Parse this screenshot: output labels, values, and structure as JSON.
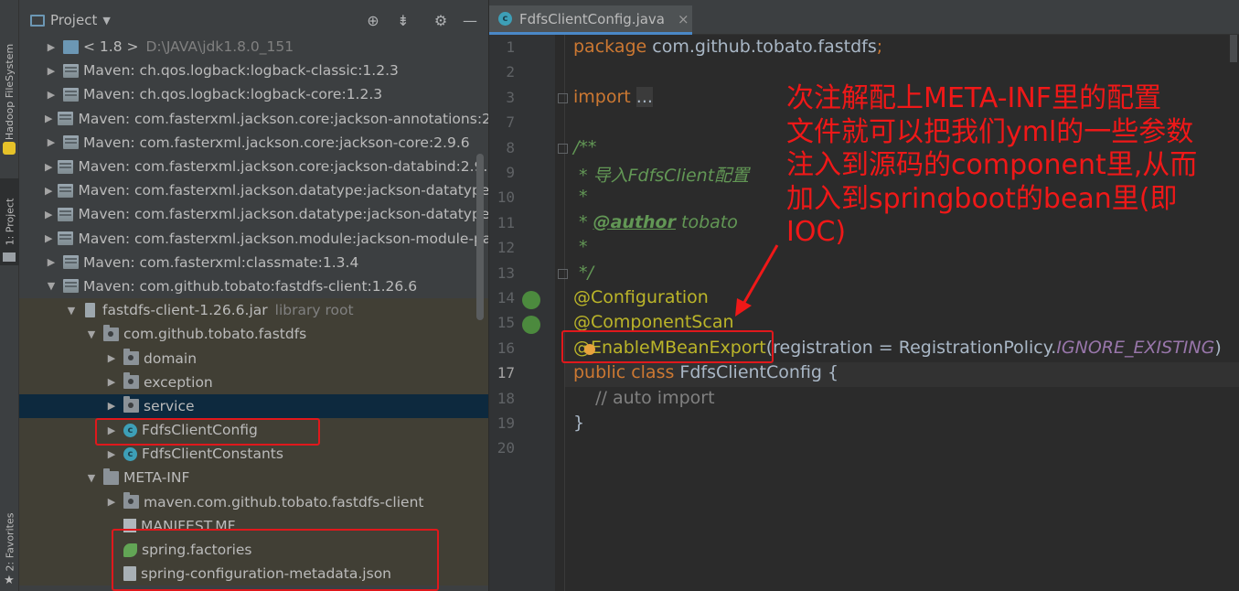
{
  "sidebar": {
    "tabs": [
      {
        "label": "Hadoop FileSystem"
      },
      {
        "label": "1: Project"
      },
      {
        "label": "2: Favorites"
      }
    ]
  },
  "project_panel": {
    "title": "Project",
    "toolbar_icons": [
      "crosshair-icon",
      "collapse-icon",
      "gear-icon",
      "minimize-icon"
    ],
    "tree": [
      {
        "text": "< 1.8 >",
        "detail": "D:\\JAVA\\jdk1.8.0_151",
        "icon": "jdk-icon",
        "expanded": false
      },
      {
        "text": "Maven: ch.qos.logback:logback-classic:1.2.3",
        "icon": "library-icon",
        "expanded": false
      },
      {
        "text": "Maven: ch.qos.logback:logback-core:1.2.3",
        "icon": "library-icon",
        "expanded": false
      },
      {
        "text": "Maven: com.fasterxml.jackson.core:jackson-annotations:2.",
        "icon": "library-icon",
        "expanded": false
      },
      {
        "text": "Maven: com.fasterxml.jackson.core:jackson-core:2.9.6",
        "icon": "library-icon",
        "expanded": false
      },
      {
        "text": "Maven: com.fasterxml.jackson.core:jackson-databind:2.9.6",
        "icon": "library-icon",
        "expanded": false
      },
      {
        "text": "Maven: com.fasterxml.jackson.datatype:jackson-datatype-",
        "icon": "library-icon",
        "expanded": false
      },
      {
        "text": "Maven: com.fasterxml.jackson.datatype:jackson-datatype-",
        "icon": "library-icon",
        "expanded": false
      },
      {
        "text": "Maven: com.fasterxml.jackson.module:jackson-module-pa",
        "icon": "library-icon",
        "expanded": false
      },
      {
        "text": "Maven: com.fasterxml:classmate:1.3.4",
        "icon": "library-icon",
        "expanded": false
      },
      {
        "text": "Maven: com.github.tobato:fastdfs-client:1.26.6",
        "icon": "library-icon",
        "expanded": true
      },
      {
        "text": "fastdfs-client-1.26.6.jar",
        "detail": "library root",
        "icon": "jar-icon",
        "expanded": true
      },
      {
        "text": "com.github.tobato.fastdfs",
        "icon": "package-icon",
        "expanded": true
      },
      {
        "text": "domain",
        "icon": "package-icon",
        "expanded": false
      },
      {
        "text": "exception",
        "icon": "package-icon",
        "expanded": false
      },
      {
        "text": "service",
        "icon": "package-icon",
        "expanded": false,
        "selected": true
      },
      {
        "text": "FdfsClientConfig",
        "icon": "class-icon",
        "expanded": false
      },
      {
        "text": "FdfsClientConstants",
        "icon": "class-icon",
        "expanded": false
      },
      {
        "text": "META-INF",
        "icon": "folder-icon",
        "expanded": true
      },
      {
        "text": "maven.com.github.tobato.fastdfs-client",
        "icon": "package-icon",
        "expanded": false
      },
      {
        "text": "MANIFEST.MF",
        "icon": "manifest-icon"
      },
      {
        "text": "spring.factories",
        "icon": "spring-icon"
      },
      {
        "text": "spring-configuration-metadata.json",
        "icon": "json-icon"
      }
    ]
  },
  "editor": {
    "tab": {
      "label": "FdfsClientConfig.java",
      "close": "×"
    },
    "lines": [
      {
        "n": "1",
        "parts": [
          [
            "kw",
            "package "
          ],
          [
            "plain",
            "com.github.tobato.fastdfs"
          ],
          [
            "kw",
            ";"
          ]
        ]
      },
      {
        "n": "2",
        "parts": []
      },
      {
        "n": "3",
        "parts": [
          [
            "kw",
            "import "
          ],
          [
            "foldtxt",
            "..."
          ]
        ]
      },
      {
        "n": "7",
        "parts": []
      },
      {
        "n": "8",
        "parts": [
          [
            "cm",
            "/**"
          ]
        ]
      },
      {
        "n": "9",
        "parts": [
          [
            "cm",
            " * 导入FdfsClient配置"
          ]
        ]
      },
      {
        "n": "10",
        "parts": [
          [
            "cm",
            " *"
          ]
        ]
      },
      {
        "n": "11",
        "parts": [
          [
            "cm",
            " * "
          ],
          [
            "cmtag",
            "@author"
          ],
          [
            "cm",
            " tobato"
          ]
        ]
      },
      {
        "n": "12",
        "parts": [
          [
            "cm",
            " *"
          ]
        ]
      },
      {
        "n": "13",
        "parts": [
          [
            "cm",
            " */"
          ]
        ]
      },
      {
        "n": "14",
        "parts": [
          [
            "ann",
            "@Configuration"
          ]
        ]
      },
      {
        "n": "15",
        "parts": [
          [
            "ann",
            "@ComponentScan"
          ]
        ]
      },
      {
        "n": "16",
        "parts": [
          [
            "ann",
            "@EnableMBeanExport"
          ],
          [
            "plain",
            "(registration = RegistrationPolicy."
          ],
          [
            "const",
            "IGNORE_EXISTING"
          ],
          [
            "plain",
            ")"
          ]
        ]
      },
      {
        "n": "17",
        "parts": [
          [
            "kw",
            "public class "
          ],
          [
            "plain",
            "FdfsClientConfig {"
          ]
        ],
        "current": true
      },
      {
        "n": "18",
        "parts": [
          [
            "grey",
            "    // auto import"
          ]
        ]
      },
      {
        "n": "19",
        "parts": [
          [
            "plain",
            "}"
          ]
        ]
      },
      {
        "n": "20",
        "parts": []
      }
    ]
  },
  "annotation_note": {
    "lines": [
      "次注解配上META-INF里的配置",
      "文件就可以把我们yml的一些参数",
      "注入到源码的component里,从而",
      "加入到springboot的bean里(即",
      "IOC)"
    ],
    "color": "#f01818"
  },
  "colors": {
    "keyword": "#cc7832",
    "annotation": "#bbb529",
    "comment": "#629755",
    "highlight_box": "#e0181c",
    "selection": "#0d293e"
  }
}
